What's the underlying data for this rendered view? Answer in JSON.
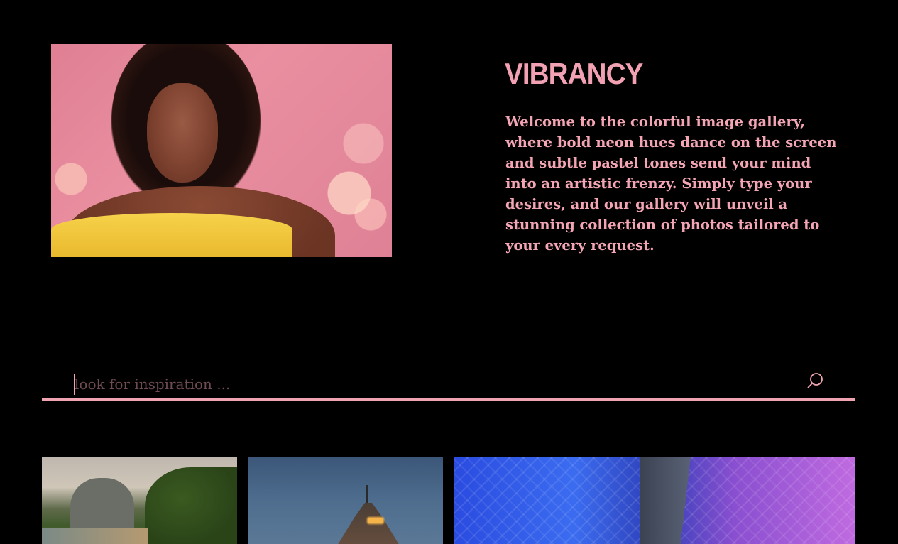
{
  "hero": {
    "title": "VIBRANCY",
    "intro": "Welcome to the colorful image gallery, where bold neon hues dance on the screen and subtle pastel tones send your mind into an artistic frenzy. Simply type your desires, and our gallery will unveil a stunning collection of photos tailored to your every request."
  },
  "search": {
    "placeholder": "look for inspiration ...",
    "value": "",
    "icon": "search-icon"
  },
  "colors": {
    "background": "#000000",
    "accent": "#f1a1b2"
  }
}
